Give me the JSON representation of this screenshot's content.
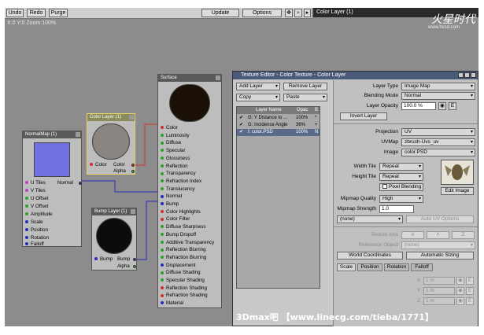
{
  "toolbar": {
    "undo": "Undo",
    "redo": "Redo",
    "purge": "Purge",
    "update": "Update",
    "options": "Options",
    "canvas_info": "X:0 Y:0 Zoom:100%"
  },
  "right_panel_title": "Color Layer (1)",
  "logo": {
    "brand": "火星时代",
    "url": "www.hxsd.com"
  },
  "nodes": {
    "normalmap": {
      "title": "NormalMap (1)",
      "inputs": [
        "U Tiles",
        "V Tiles",
        "U Offset",
        "V Offset",
        "Amplitude",
        "Scale",
        "Position",
        "Rotation",
        "Falloff"
      ],
      "output": "Normal"
    },
    "colorlayer": {
      "title": "Color Layer (1)",
      "left_port": "Color",
      "right_port": "Color",
      "alpha": "Alpha"
    },
    "bumplayer": {
      "title": "Bump Layer (1)",
      "left_port": "Bump",
      "right_port": "Bump",
      "alpha": "Alpha"
    },
    "surface": {
      "title": "Surface",
      "inputs": [
        "Color",
        "Luminosity",
        "Diffuse",
        "Specular",
        "Glossiness",
        "Reflection",
        "Transparency",
        "Refraction Index",
        "Translucency",
        "Normal",
        "Bump",
        "Color Highlights",
        "Color Filter",
        "Diffuse Sharpness",
        "Bump Dropoff",
        "Additive Transparency",
        "Reflection Blurring",
        "Refraction Blurring",
        "Displacement",
        "Diffuse Shading",
        "Specular Shading",
        "Reflection Shading",
        "Refraction Shading",
        "Material"
      ]
    }
  },
  "texture_editor": {
    "title": "Texture Editor - Color Texture - Color Layer",
    "add_layer": "Add Layer",
    "remove_layer": "Remove Layer",
    "copy": "Copy",
    "paste": "Paste",
    "list_headers": {
      "name": "Layer Name",
      "opacity": "Opac",
      "blend": "B"
    },
    "layers": [
      {
        "name": "G: Y Distance to ...",
        "opacity": "100%",
        "blend": "*"
      },
      {
        "name": "G: Incidence Angle",
        "opacity": "36%",
        "blend": "+"
      },
      {
        "name": "I: color.PSD",
        "opacity": "100%",
        "blend": "N"
      }
    ],
    "layer_type_label": "Layer Type",
    "layer_type": "Image Map",
    "blending_mode_label": "Blending Mode",
    "blending_mode": "Normal",
    "layer_opacity_label": "Layer Opacity",
    "layer_opacity": "100.0 %",
    "invert_layer": "Invert Layer",
    "projection_label": "Projection",
    "projection": "UV",
    "uvmap_label": "UVMap",
    "uvmap": "zbrush-Uvs_uv",
    "image_label": "Image",
    "image": "color.PSD",
    "width_tile_label": "Width Tile",
    "width_tile": "Repeat",
    "height_tile_label": "Height Tile",
    "height_tile": "Repeat",
    "pixel_blending": "Pixel Blending",
    "edit_image": "Edit Image",
    "mipmap_quality_label": "Mipmap Quality",
    "mipmap_quality": "High",
    "mipmap_strength_label": "Mipmap Strength",
    "mipmap_strength": "1.0",
    "none_select": "(none)",
    "auto_uv": "Auto UV Options",
    "texture_axis_label": "Texture Axis",
    "axis_x": "X",
    "axis_y": "Y",
    "axis_z": "Z",
    "reference_object_label": "Reference Object",
    "reference_object": "(none)",
    "world_coordinates": "World Coordinates",
    "automatic_sizing": "Automatic Sizing",
    "tabs": [
      "Scale",
      "Position",
      "Rotation",
      "Falloff"
    ],
    "scale_x_label": "X",
    "scale_x": "1 m",
    "scale_y_label": "Y",
    "scale_y": "1 m",
    "scale_z_label": "Z",
    "scale_z": "1 m"
  },
  "watermark": "3Dmax吧  【www.linecg.com/tieba/1771】"
}
